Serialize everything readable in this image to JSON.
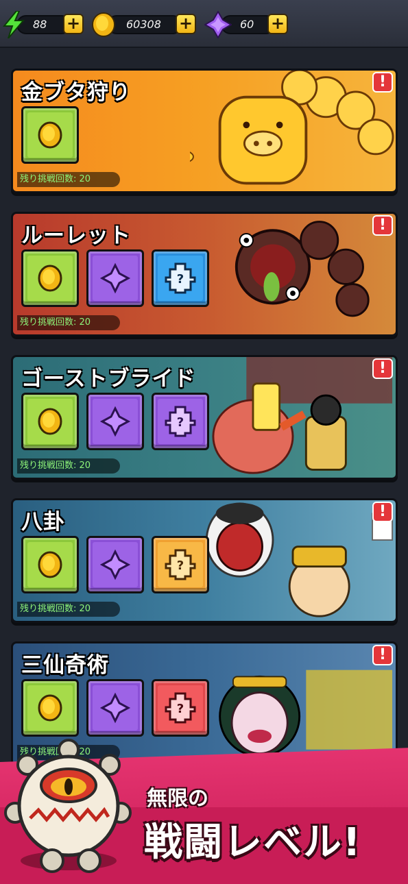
{
  "resources": {
    "energy": {
      "value": "88",
      "icon": "lightning-icon"
    },
    "gold": {
      "value": "60308",
      "icon": "gold-coin-icon"
    },
    "gem": {
      "value": "60",
      "icon": "purple-gem-icon"
    },
    "plus_label": "+"
  },
  "cards": [
    {
      "title": "金ブタ狩り",
      "remaining": "残り挑戦回数: 20",
      "alert": "!",
      "rewards": [
        "gold"
      ],
      "theme": "#f39a21"
    },
    {
      "title": "ルーレット",
      "remaining": "残り挑戦回数: 20",
      "alert": "!",
      "rewards": [
        "gold",
        "gem",
        "random-blue"
      ],
      "theme": "#c6442f"
    },
    {
      "title": "ゴーストブライド",
      "remaining": "残り挑戦回数: 20",
      "alert": "!",
      "rewards": [
        "gold",
        "gem",
        "random-purple"
      ],
      "theme": "#2d7a88"
    },
    {
      "title": "八卦",
      "remaining": "残り挑戦回数: 20",
      "alert": "!",
      "rewards": [
        "gold",
        "gem",
        "random-orange"
      ],
      "theme": "#2f6f8f"
    },
    {
      "title": "三仙奇術",
      "remaining": "残り挑戦回数: 20",
      "alert": "!",
      "rewards": [
        "gold",
        "gem",
        "random-red"
      ],
      "theme": "#2e5d8c"
    }
  ],
  "banner": {
    "line1": "無限の",
    "line2": "戦闘レベル!"
  }
}
